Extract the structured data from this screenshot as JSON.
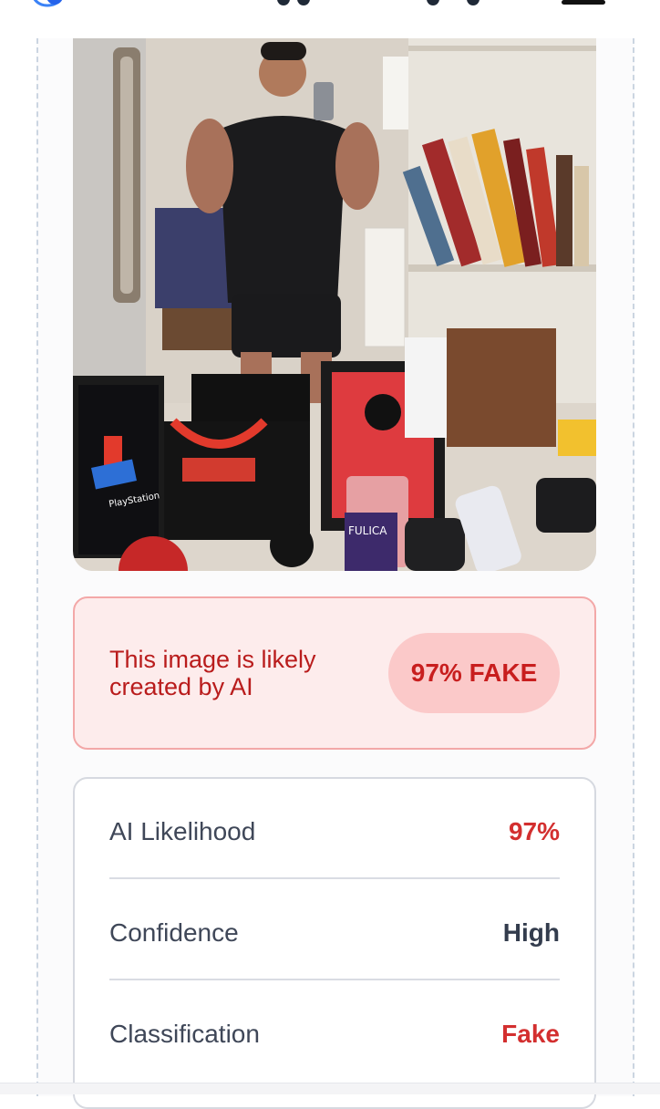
{
  "header": {
    "logo_icon": "brain-hands-icon",
    "menu_icon": "hamburger-menu-icon"
  },
  "photo": {
    "subject": "mirror-selfie-photo",
    "visible_text": [
      "PlayStation",
      "FULICA"
    ]
  },
  "verdict": {
    "message": "This image is likely created by AI",
    "badge": "97% FAKE",
    "colors": {
      "background": "#fdecec",
      "border": "#f3a8a8",
      "text": "#b91c1c",
      "badge_bg": "#fbc9c9"
    }
  },
  "details": {
    "rows": [
      {
        "label": "AI Likelihood",
        "value": "97%",
        "color": "#d32f2f"
      },
      {
        "label": "Confidence",
        "value": "High",
        "color": "#333c4d"
      },
      {
        "label": "Classification",
        "value": "Fake",
        "color": "#d32f2f"
      }
    ]
  }
}
